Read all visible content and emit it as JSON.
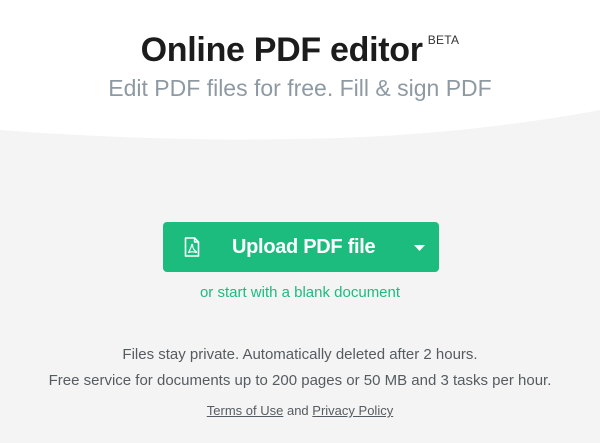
{
  "header": {
    "title": "Online PDF editor",
    "badge": "BETA",
    "subtitle": "Edit PDF files for free. Fill & sign PDF"
  },
  "upload": {
    "button_label": "Upload PDF file",
    "file_icon": "pdf-file-icon",
    "dropdown_icon": "caret-down-icon",
    "blank_document_link": "or start with a blank document"
  },
  "info": {
    "line1": "Files stay private. Automatically deleted after 2 hours.",
    "line2": "Free service for documents up to 200 pages or 50 MB and 3 tasks per hour."
  },
  "footer": {
    "terms_label": "Terms of Use",
    "conjunction": "and",
    "privacy_label": "Privacy Policy"
  },
  "colors": {
    "accent": "#1cbc7e",
    "hero_background": "#ffffff",
    "page_background": "#f4f4f4",
    "title_text": "#1c1c1c",
    "subtitle_text": "#8e9aa3",
    "body_text": "#555c61"
  }
}
